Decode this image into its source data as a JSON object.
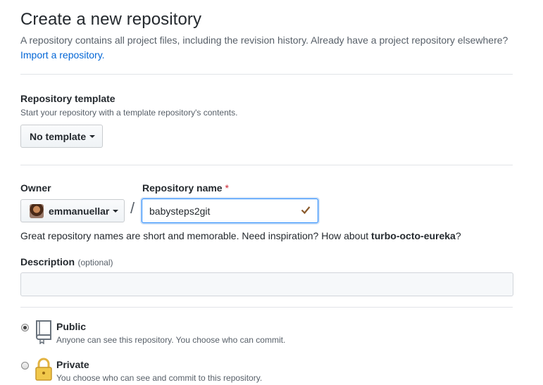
{
  "header": {
    "title": "Create a new repository",
    "subtitle": "A repository contains all project files, including the revision history. Already have a project repository elsewhere?",
    "import_link": "Import a repository."
  },
  "template": {
    "label": "Repository template",
    "note": "Start your repository with a template repository's contents.",
    "button": "No template"
  },
  "owner": {
    "label": "Owner",
    "value": "emmanuellar"
  },
  "repo": {
    "label": "Repository name",
    "required_mark": "*",
    "value": "babysteps2git",
    "separator": "/"
  },
  "hint": {
    "text": "Great repository names are short and memorable. Need inspiration? How about ",
    "suggestion": "turbo-octo-eureka",
    "end": "?"
  },
  "description": {
    "label": "Description",
    "optional": "(optional)",
    "value": ""
  },
  "visibility": {
    "public": {
      "title": "Public",
      "note": "Anyone can see this repository. You choose who can commit.",
      "selected": true
    },
    "private": {
      "title": "Private",
      "note": "You choose who can see and commit to this repository.",
      "selected": false
    }
  },
  "colors": {
    "link": "#0366d6",
    "required": "#cb2431",
    "valid_check": "#8a5a2b",
    "focus_border": "#2188ff"
  },
  "icons": {
    "caret": "caret-down-icon",
    "check": "check-icon",
    "public": "repo-book-icon",
    "private": "lock-icon",
    "avatar": "avatar"
  }
}
